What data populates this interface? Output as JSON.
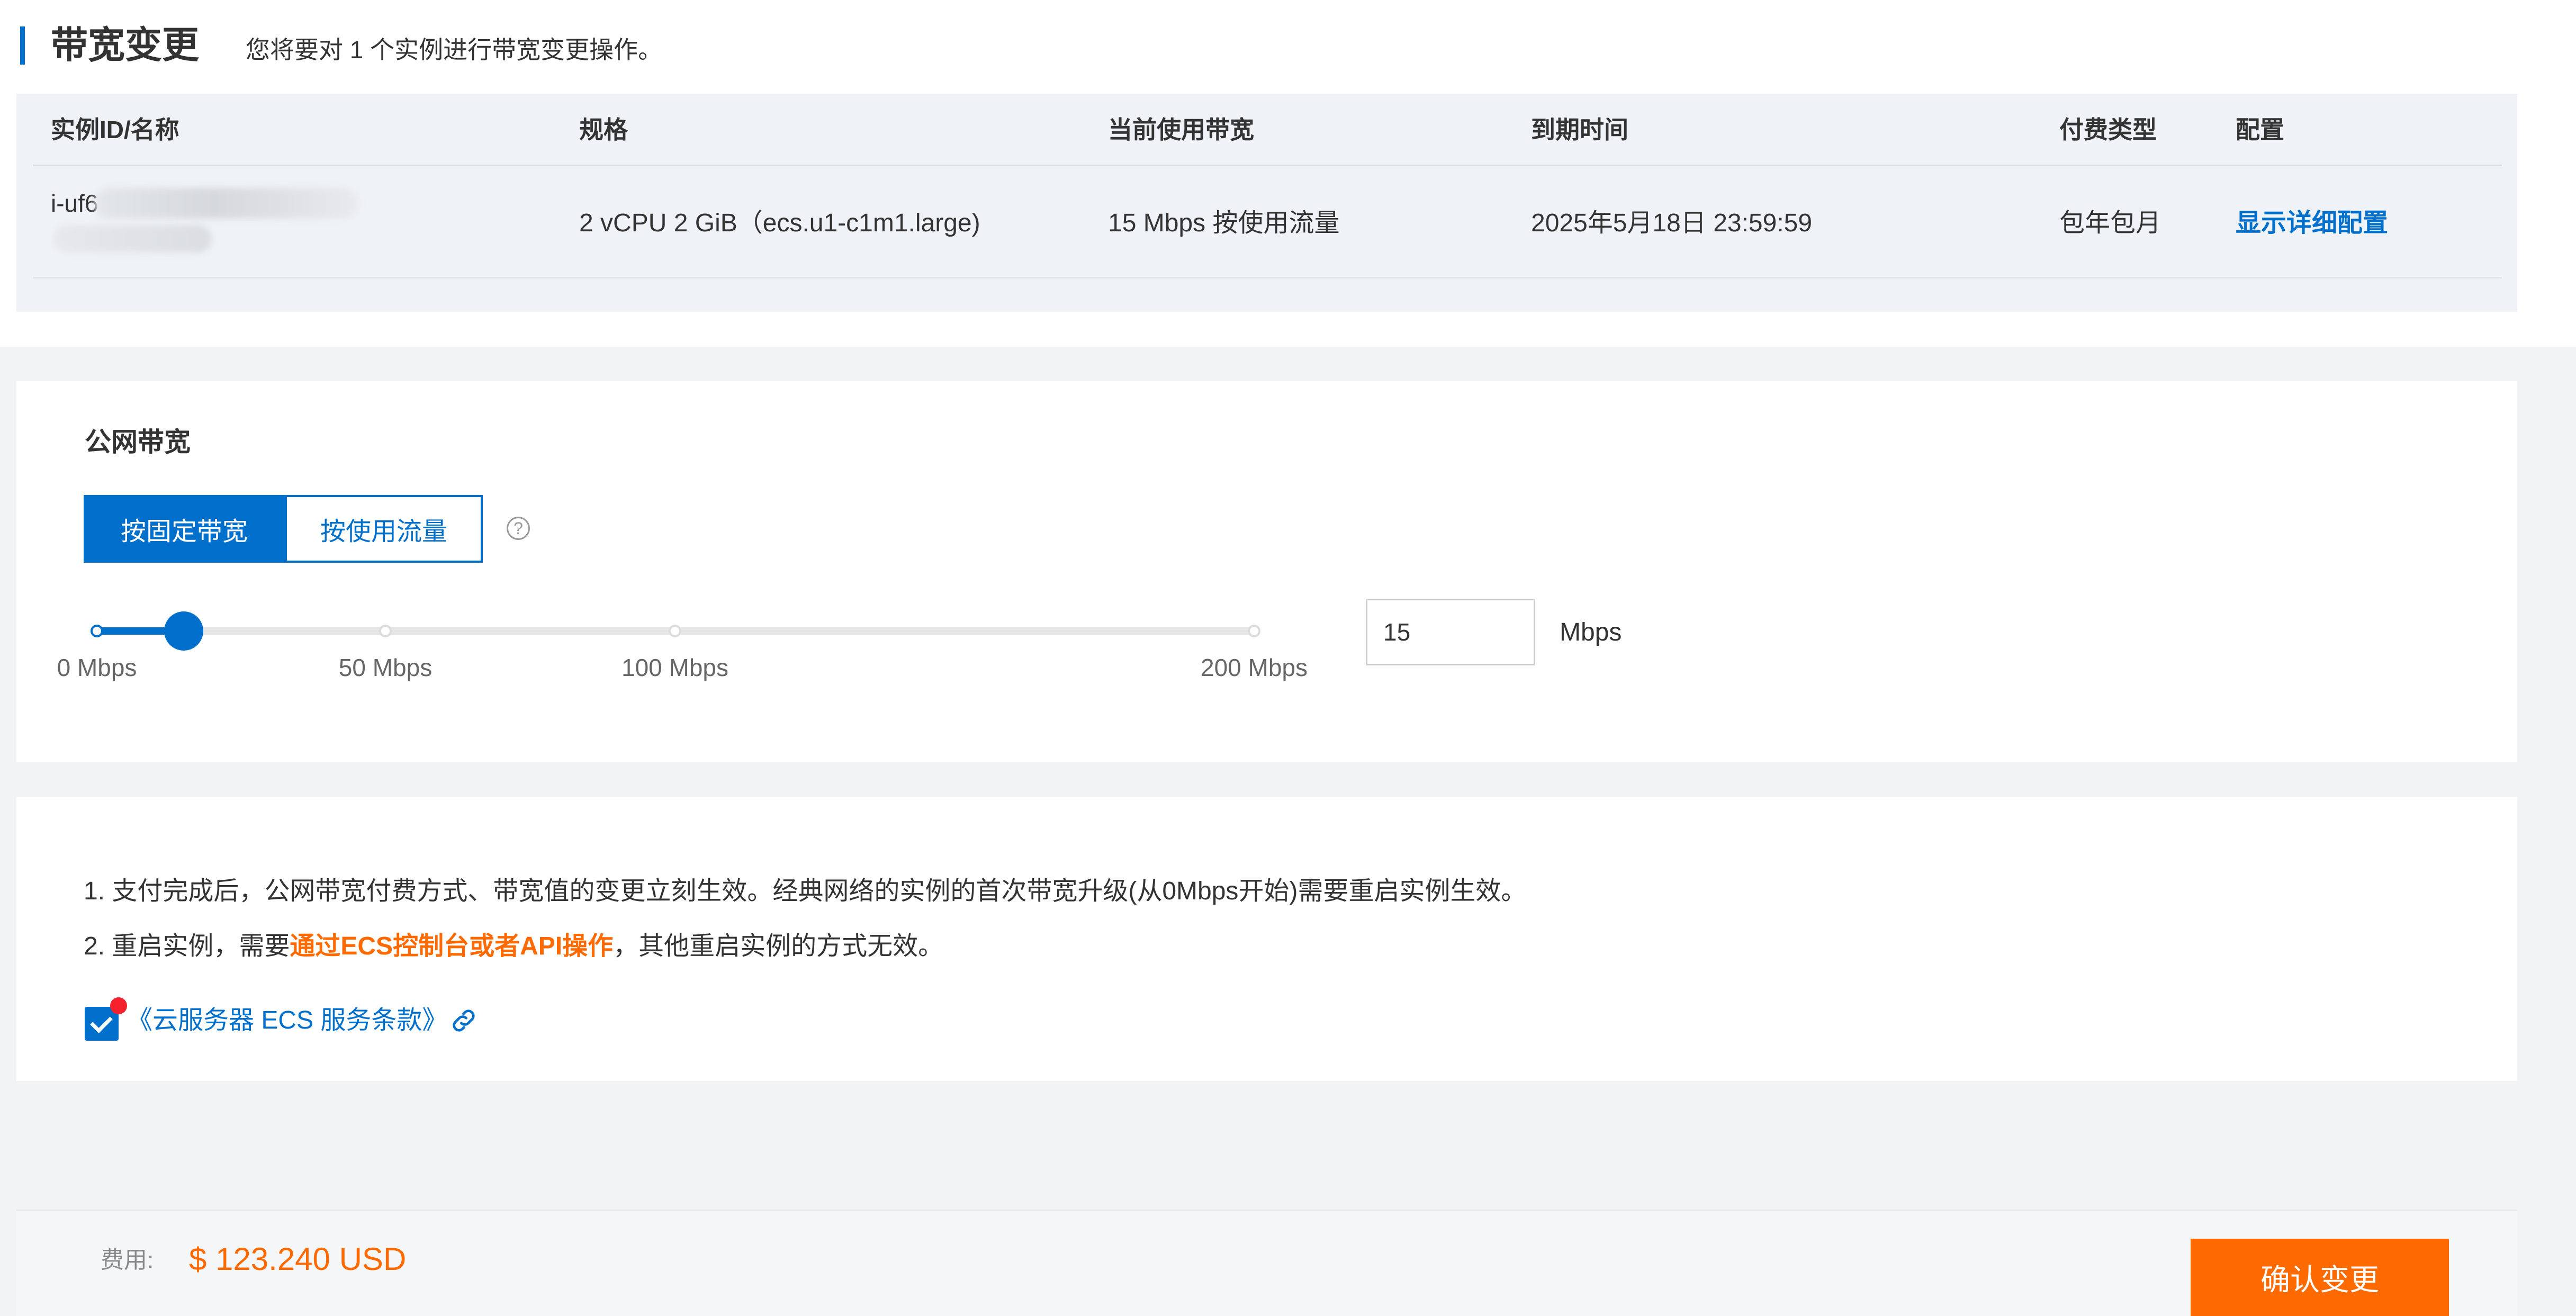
{
  "header": {
    "title": "带宽变更",
    "subtitle": "您将要对 1 个实例进行带宽变更操作。"
  },
  "instance_table": {
    "columns": [
      "实例ID/名称",
      "规格",
      "当前使用带宽",
      "到期时间",
      "付费类型",
      "配置"
    ],
    "row": {
      "instance_id": "i-uf6",
      "spec": "2 vCPU 2 GiB（ecs.u1-c1m1.large)",
      "current_bandwidth": "15 Mbps 按使用流量",
      "expiry": "2025年5月18日 23:59:59",
      "billing_type": "包年包月",
      "config_link": "显示详细配置"
    }
  },
  "bandwidth": {
    "section_label": "公网带宽",
    "mode_fixed": "按固定带宽",
    "mode_traffic": "按使用流量",
    "selected_mode": "按固定带宽",
    "help_icon": "?",
    "slider_value_mbps": 15,
    "slider_ticks": [
      {
        "value": 0,
        "label": "0 Mbps"
      },
      {
        "value": 50,
        "label": "50 Mbps"
      },
      {
        "value": 100,
        "label": "100 Mbps"
      },
      {
        "value": 200,
        "label": "200 Mbps"
      }
    ],
    "input_value": "15",
    "unit": "Mbps"
  },
  "notes": {
    "line1": "1. 支付完成后，公网带宽付费方式、带宽值的变更立刻生效。经典网络的实例的首次带宽升级(从0Mbps开始)需要重启实例生效。",
    "line2_prefix": "2. 重启实例，需要",
    "line2_highlight": "通过ECS控制台或者API操作",
    "line2_suffix": "，其他重启实例的方式无效。",
    "agreement_checked": true,
    "terms_link": "《云服务器 ECS 服务条款》"
  },
  "footer": {
    "fee_label": "费用:",
    "fee_value": "$ 123.240 USD",
    "confirm_button": "确认变更"
  },
  "colors": {
    "primary": "#0070cc",
    "accent": "#ff6a00",
    "alert_dot": "#f5222d"
  }
}
